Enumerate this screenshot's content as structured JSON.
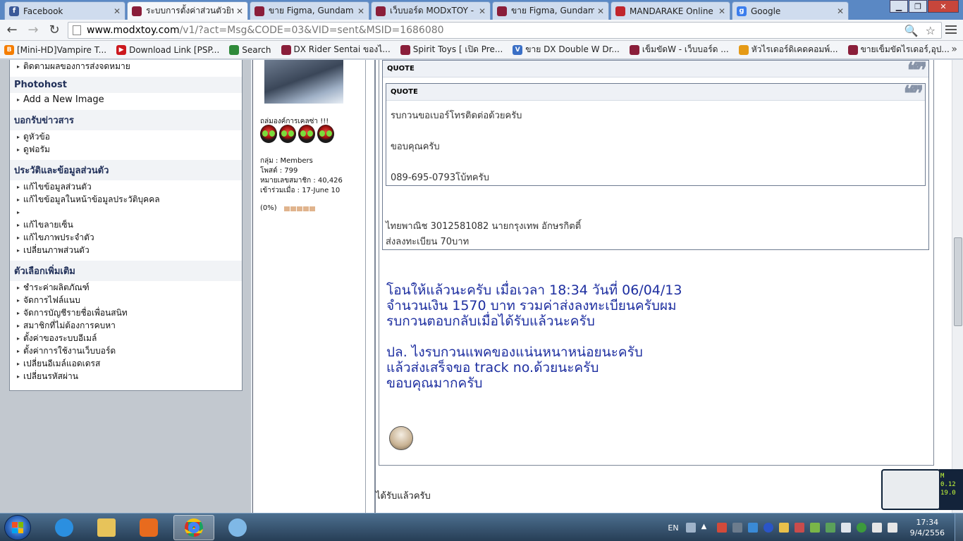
{
  "browser": {
    "tabs": [
      {
        "title": "Facebook",
        "icon": "facebook-icon",
        "color": "#3b5998",
        "glyph": "f"
      },
      {
        "title": "ระบบการตั้งค่าส่วนตัวยินดี",
        "icon": "modxtoy-icon",
        "color": "#8a1e3a",
        "glyph": ""
      },
      {
        "title": "ขาย Figma, Gundam ฯ",
        "icon": "modxtoy-icon",
        "color": "#8a1e3a",
        "glyph": ""
      },
      {
        "title": "เว็บบอร์ด MODxTOY -",
        "icon": "modxtoy-icon",
        "color": "#8a1e3a",
        "glyph": ""
      },
      {
        "title": "ขาย Figma, Gundam ฯ",
        "icon": "modxtoy-icon",
        "color": "#8a1e3a",
        "glyph": ""
      },
      {
        "title": "MANDARAKE Online",
        "icon": "mandarake-icon",
        "color": "#c0262d",
        "glyph": ""
      },
      {
        "title": "Google",
        "icon": "google-icon",
        "color": "#3b7ded",
        "glyph": "g"
      }
    ],
    "url_host": "www.modxtoy.com",
    "url_path": "/v1/?act=Msg&CODE=03&VID=sent&MSID=1686080",
    "bookmarks": [
      {
        "label": "[Mini-HD]Vampire T...",
        "icon": "blogger-icon",
        "color": "#f57d00"
      },
      {
        "label": "Download Link [PSP...",
        "icon": "youtube-icon",
        "color": "#cc181e"
      },
      {
        "label": "Search",
        "icon": "search-site-icon",
        "color": "#2f8a3a"
      },
      {
        "label": "DX Rider Sentai ของไ...",
        "icon": "modxtoy-icon",
        "color": "#8a1e3a"
      },
      {
        "label": "Spirit Toys [ เปิด Pre...",
        "icon": "modxtoy-icon",
        "color": "#8a1e3a"
      },
      {
        "label": "ขาย DX Double W Dr...",
        "icon": "bookmark-v-icon",
        "color": "#3a6fc6"
      },
      {
        "label": "เข็มขัดW - เว็บบอร์ด ...",
        "icon": "modxtoy-icon",
        "color": "#8a1e3a"
      },
      {
        "label": "หัวไรเดอร์ดิเคดคอมพ์...",
        "icon": "bookmark-file-icon",
        "color": "#e59a16"
      },
      {
        "label": "ขายเข็มขัดไรเดอร์,อุป...",
        "icon": "modxtoy-icon",
        "color": "#8a1e3a"
      }
    ]
  },
  "sidebar": {
    "top_item": "ติดตามผลของการส่งจดหมาย",
    "sections": [
      {
        "title": "Photohost",
        "items": [
          "Add a New Image"
        ]
      },
      {
        "title": "บอกรับข่าวสาร",
        "items": [
          "ดูหัวข้อ",
          "ดูฟอรัม"
        ]
      },
      {
        "title": "ประวัติและข้อมูลส่วนตัว",
        "items": [
          "แก้ไขข้อมูลส่วนตัว",
          "แก้ไขข้อมูลในหน้าข้อมูลประวัติบุคคล",
          "",
          "แก้ไขลายเซ็น",
          "แก้ไขภาพประจำตัว",
          "เปลี่ยนภาพส่วนตัว"
        ]
      },
      {
        "title": "ตัวเลือกเพิ่มเติม",
        "items": [
          "ชำระค่าผลิตภัณฑ์",
          "จัดการไฟล์แนบ",
          "จัดการบัญชีรายชื่อเพื่อนสนิท",
          "สมาชิกที่ไม่ต้องการคบหา",
          "ตั้งค่าของระบบอีเมล์",
          "ตั้งค่าการใช้งานเว็บบอร์ด",
          "เปลี่ยนอีเมล์แอดเดรส",
          "เปลี่ยนรหัสผ่าน"
        ]
      }
    ]
  },
  "user": {
    "rank_title": "ถล่มองค์การเคลซ่า !!!",
    "group": "กลุ่ม : Members",
    "posts": "โพสต์ : 799",
    "member_no": "หมายเลขสมาชิก : 40,426",
    "joined": "เข้าร่วมเมื่อ : 17-June 10",
    "reputation": "(0%)"
  },
  "post": {
    "quote_label": "QUOTE",
    "inner_quote_label": "QUOTE",
    "inner_quote_lines": [
      "รบกวนขอเบอร์โทรติดต่อด้วยครับ",
      "ขอบคุณครับ",
      "089-695-0793โบ้ทครับ"
    ],
    "outer_quote_lines": [
      "ไทยพาณิช 3012581082 นายกรุงเทพ อักษรกิตติ์",
      "ส่งลงทะเบียน 70บาท"
    ],
    "message_lines": [
      "โอนให้แล้วนะครับ เมื่อเวลา 18:34 วันที่ 06/04/13",
      "จำนวนเงิน 1570 บาท รวมค่าส่งลงทะเบียนครับผม",
      "รบกวนตอบกลับเมื่อได้รับแล้วนะครับ",
      "",
      "ปล. ไงรบกวนแพคของแน่นหนาหน่อยนะครับ",
      "แล้วส่งเสร็จขอ track no.ด้วยนะครับ",
      "ขอบคุณมากครับ"
    ],
    "reply_preview": "ได้รับแล้วครับ"
  },
  "gadget": {
    "line1": "M",
    "line2": "0.12",
    "line3": "19.0"
  },
  "taskbar": {
    "lang": "EN",
    "time": "17:34",
    "date": "9/4/2556",
    "apps": [
      {
        "name": "ie-icon",
        "color": "#2b8fe0"
      },
      {
        "name": "explorer-icon",
        "color": "#e7c35a"
      },
      {
        "name": "media-player-icon",
        "color": "#e86b1e"
      },
      {
        "name": "chrome-icon",
        "color": "#d93025"
      },
      {
        "name": "paint-icon",
        "color": "#7fb8e6"
      }
    ]
  }
}
